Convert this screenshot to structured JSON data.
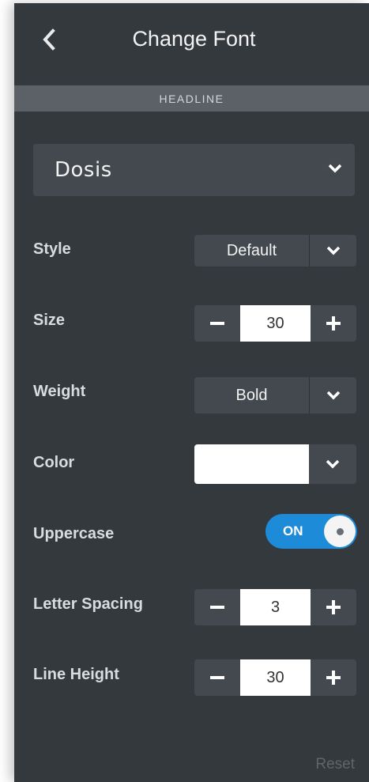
{
  "header": {
    "title": "Change Font"
  },
  "section": {
    "label": "HEADLINE"
  },
  "font": {
    "selected": "Dosis"
  },
  "rows": {
    "style": {
      "label": "Style",
      "value": "Default"
    },
    "size": {
      "label": "Size",
      "value": "30"
    },
    "weight": {
      "label": "Weight",
      "value": "Bold"
    },
    "color": {
      "label": "Color",
      "swatch": "#ffffff"
    },
    "uppercase": {
      "label": "Uppercase",
      "state": "ON"
    },
    "letter_spacing": {
      "label": "Letter Spacing",
      "value": "3"
    },
    "line_height": {
      "label": "Line Height",
      "value": "30"
    }
  },
  "reset_label": "Reset",
  "icons": {
    "back": "chevron-left-icon",
    "dropdown": "chevron-down-icon",
    "minus": "minus-icon",
    "plus": "plus-icon"
  },
  "colors": {
    "panel": "#34393d",
    "accent": "#1e8bd9"
  }
}
